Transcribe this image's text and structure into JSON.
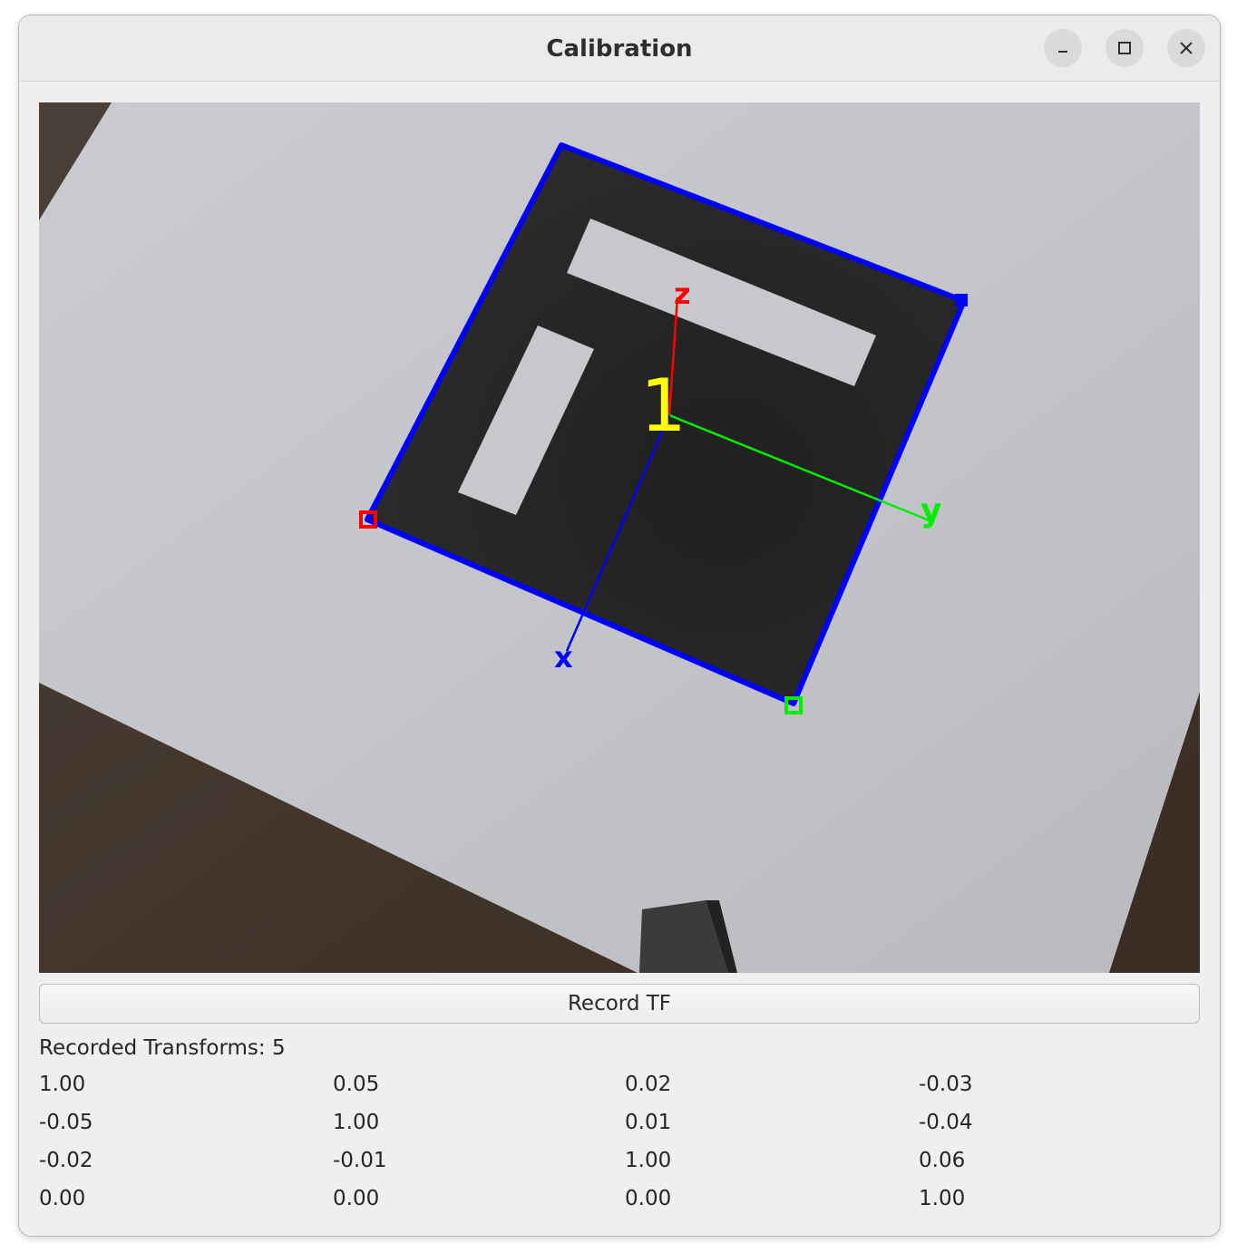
{
  "window": {
    "title": "Calibration",
    "controls": [
      "minimize-icon",
      "maximize-icon",
      "close-icon"
    ]
  },
  "camera_view": {
    "marker_id": "1",
    "axis_labels": {
      "x": "x",
      "y": "y",
      "z": "z"
    },
    "colors": {
      "marker_outline": "#0000ff",
      "x_axis": "#0000ff",
      "y_axis": "#00dd00",
      "z_axis": "#ff0000",
      "marker_id": "#ffff00",
      "corner_top_left": "#ff0000",
      "corner_bottom_right": "#00ff00",
      "corner_top_right": "#0000ff"
    }
  },
  "record_button": {
    "label": "Record TF"
  },
  "recorded": {
    "label": "Recorded Transforms: 5"
  },
  "matrix": [
    [
      "1.00",
      "0.05",
      "0.02",
      "-0.03"
    ],
    [
      "-0.05",
      "1.00",
      "0.01",
      "-0.04"
    ],
    [
      "-0.02",
      "-0.01",
      "1.00",
      "0.06"
    ],
    [
      "0.00",
      "0.00",
      "0.00",
      "1.00"
    ]
  ]
}
